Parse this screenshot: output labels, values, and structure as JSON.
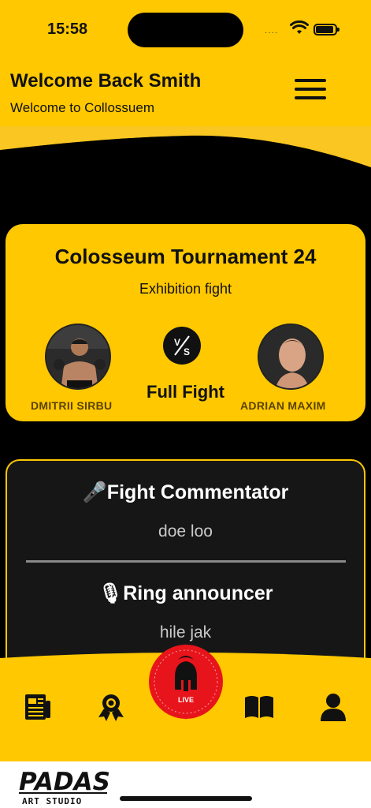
{
  "status_bar": {
    "time": "15:58",
    "signal": "····"
  },
  "header": {
    "title": "Welcome Back Smith",
    "subtitle": "Welcome to Collossuem"
  },
  "match": {
    "title": "Colosseum Tournament 24",
    "subtitle": "Exhibition fight",
    "left_fighter": "DMITRII SIRBU",
    "right_fighter": "ADRIAN MAXIM",
    "vs_label": "V/S",
    "status": "Full Fight"
  },
  "commentary": [
    {
      "role": "Fight Commentator",
      "name": "doe loo",
      "icon": "microphone-icon"
    },
    {
      "role": "Ring announcer",
      "name": "hile jak",
      "icon": "studio-mic-icon"
    }
  ],
  "nav": {
    "items": [
      "news-icon",
      "badge-icon",
      "live-button",
      "book-icon",
      "profile-icon"
    ],
    "live_label": "LIVE"
  },
  "footer": {
    "logo_text": "PADAS",
    "logo_sub": "ART STUDIO"
  },
  "colors": {
    "accent": "#FFC800",
    "background": "#000000",
    "panel": "#161616",
    "live_red": "#E8141B"
  }
}
